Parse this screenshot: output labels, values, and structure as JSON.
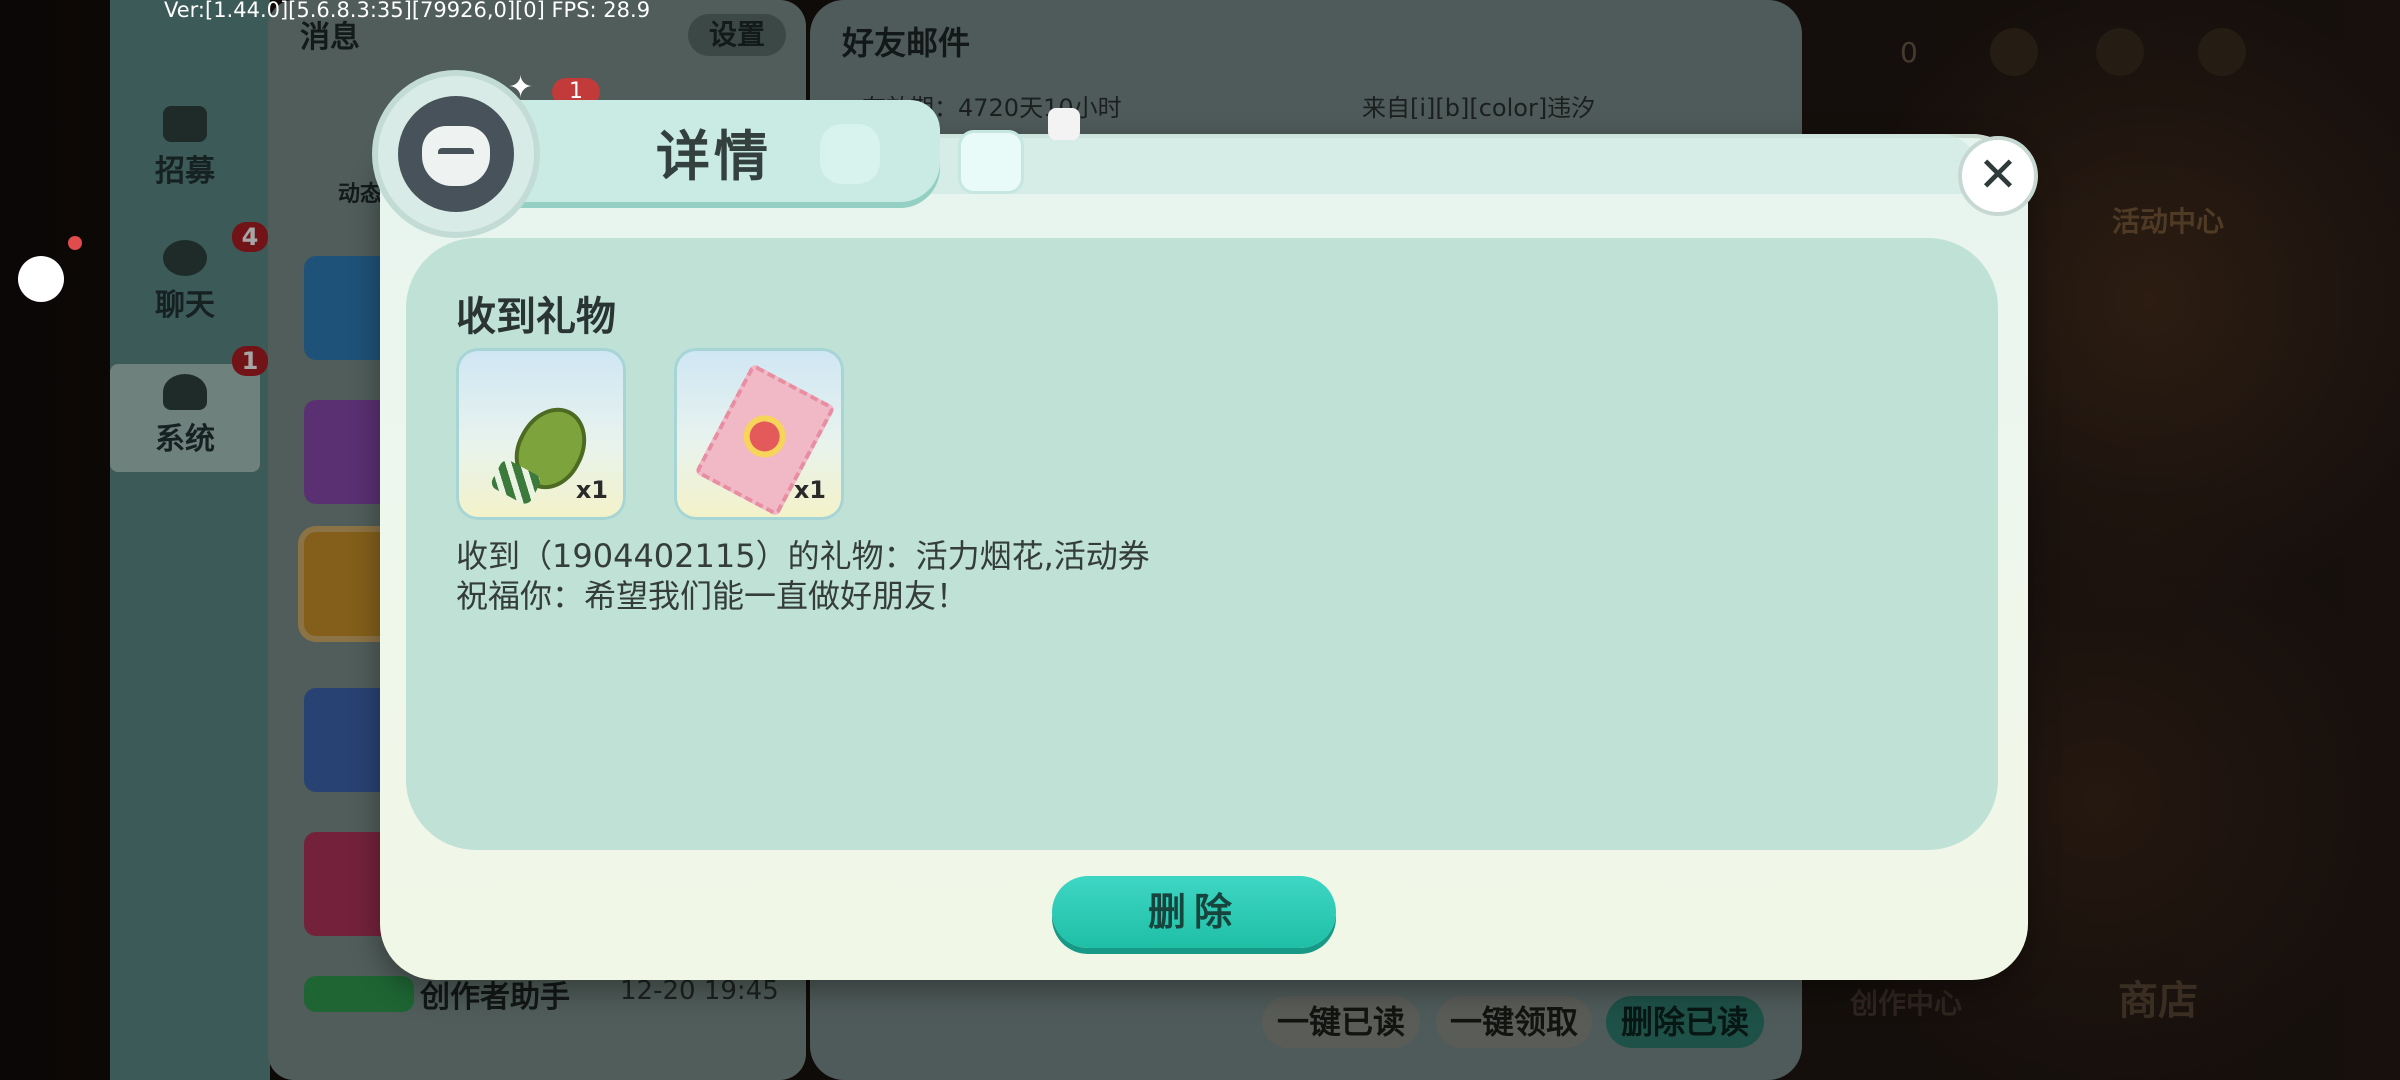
{
  "debug": {
    "fps_text": "Ver:[1.44.0][5.6.8.3:35][79926,0][0] FPS: 28.9"
  },
  "sidebar": {
    "items": [
      {
        "label": "招募",
        "badge": ""
      },
      {
        "label": "聊天",
        "badge": "4"
      },
      {
        "label": "系统",
        "badge": "1"
      }
    ]
  },
  "message_list": {
    "title": "消息",
    "settings_label": "设置",
    "tab_label": "动态",
    "tab_badge": "1",
    "creator_item": {
      "name": "创作者助手",
      "time": "12-20 19:45"
    }
  },
  "mail": {
    "title": "好友邮件",
    "expire_text": "有效期：4720天10小时",
    "from_text": "来自[i][b][color]违汐",
    "buttons": {
      "read_all": "一键已读",
      "claim_all": "一键领取",
      "delete_read": "删除已读"
    }
  },
  "hud": {
    "zero_count": "0",
    "activity_center": "活动中心",
    "shop": "商店",
    "creator_center": "创作中心"
  },
  "dialog": {
    "title": "详情",
    "close_icon": "close-icon",
    "section_title": "收到礼物",
    "gifts": [
      {
        "name": "firework-icon",
        "qty": "x1"
      },
      {
        "name": "ticket-icon",
        "qty": "x1"
      }
    ],
    "line1": "收到（1904402115）的礼物：活力烟花,活动券",
    "line2": "祝福你：希望我们能一直做好朋友！",
    "delete_label": "删除"
  },
  "colors": {
    "accent": "#1fbfa6",
    "panel": "#bfe1d6",
    "badge": "#b02024"
  }
}
